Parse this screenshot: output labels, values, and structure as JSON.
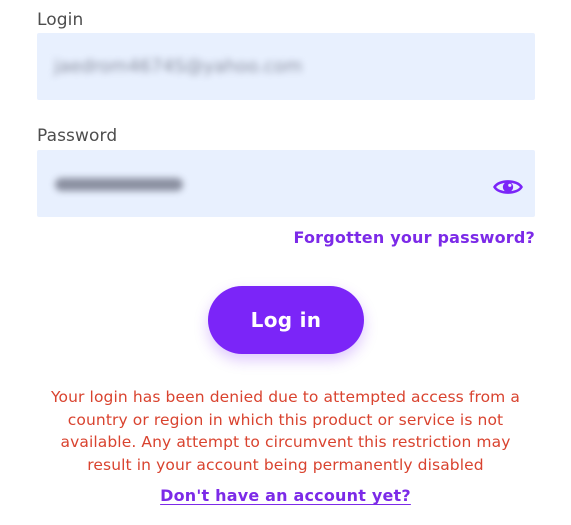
{
  "login": {
    "label": "Login",
    "value": "jaedrom4674S@yahoo.com"
  },
  "password": {
    "label": "Password",
    "masked_value": "••••••••••••",
    "visibility_icon": "eye-icon"
  },
  "forgot_password_link": "Forgotten your password?",
  "login_button": "Log in",
  "error_message": "Your login has been denied due to attempted access from a country or region in which this product or service is not available. Any attempt to circumvent this restriction may result in your account being permanently disabled",
  "signup_link": "Don't have an account yet?",
  "colors": {
    "accent": "#7b25f8",
    "error": "#d9432f",
    "field_background": "#e8f0fe"
  }
}
